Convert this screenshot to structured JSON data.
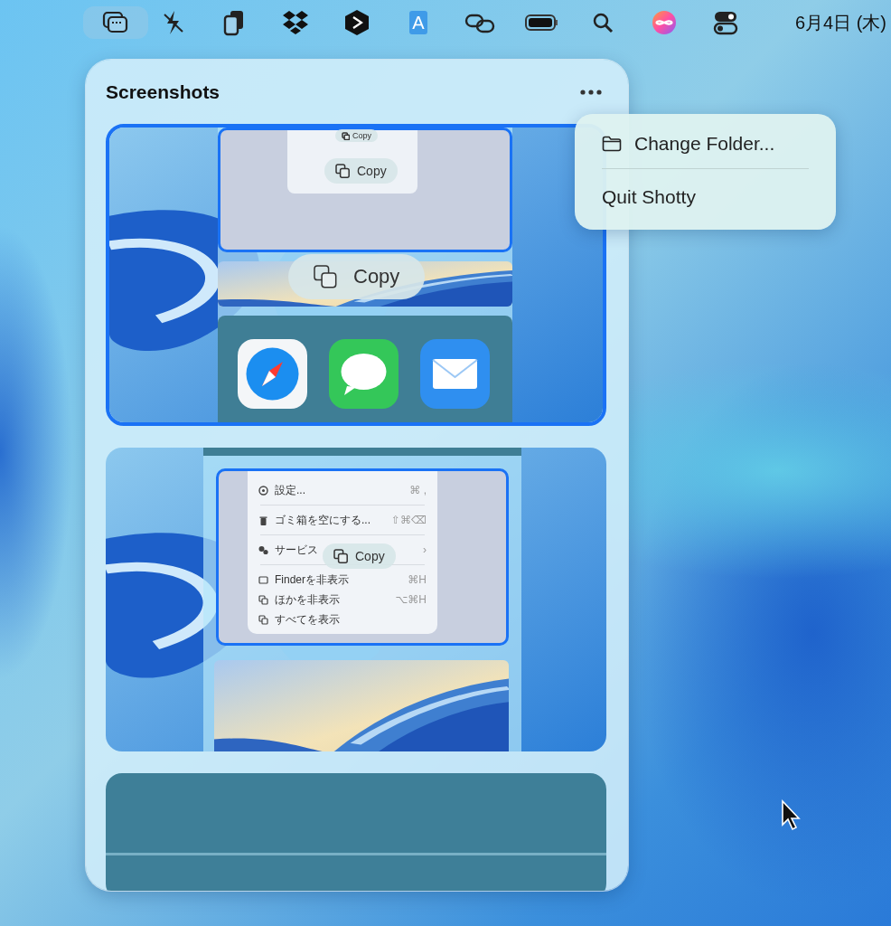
{
  "menu_bar": {
    "status_items": [
      {
        "selected": true
      },
      {
        "selected": false
      },
      {
        "selected": false
      },
      {
        "selected": false
      },
      {
        "selected": false
      },
      {
        "selected": false,
        "label": "A"
      },
      {
        "selected": false
      },
      {
        "selected": false
      },
      {
        "selected": false
      },
      {
        "selected": false
      },
      {
        "selected": false
      }
    ],
    "date": "6月4日 (木)"
  },
  "panel": {
    "title": "Screenshots",
    "thumbnails": [
      {
        "kind": "dock",
        "selected": true,
        "pills": [
          {
            "label": "Copy",
            "kind": "small"
          },
          {
            "label": "Copy",
            "kind": "medium"
          },
          {
            "label": "Copy",
            "kind": "large"
          }
        ]
      },
      {
        "kind": "menu",
        "selected": false,
        "menu_items": [
          {
            "label": "設定...",
            "shortcut": "⌘ ,"
          },
          {
            "label": "ゴミ箱を空にする...",
            "shortcut": "⇧⌘⌫"
          },
          {
            "label": "サービス",
            "shortcut": "›"
          },
          {
            "label": "Finderを非表示",
            "shortcut": "⌘H"
          },
          {
            "label": "ほかを非表示",
            "shortcut": "⌥⌘H"
          },
          {
            "label": "すべてを表示"
          }
        ],
        "pills": [
          {
            "label": "Copy",
            "kind": "medium"
          }
        ]
      },
      {
        "kind": "plain",
        "selected": false
      }
    ]
  },
  "context_menu": {
    "items": [
      {
        "label": "Change Folder...",
        "kind": "icon"
      },
      {
        "label": "Quit Shotty",
        "kind": "plain"
      }
    ]
  }
}
